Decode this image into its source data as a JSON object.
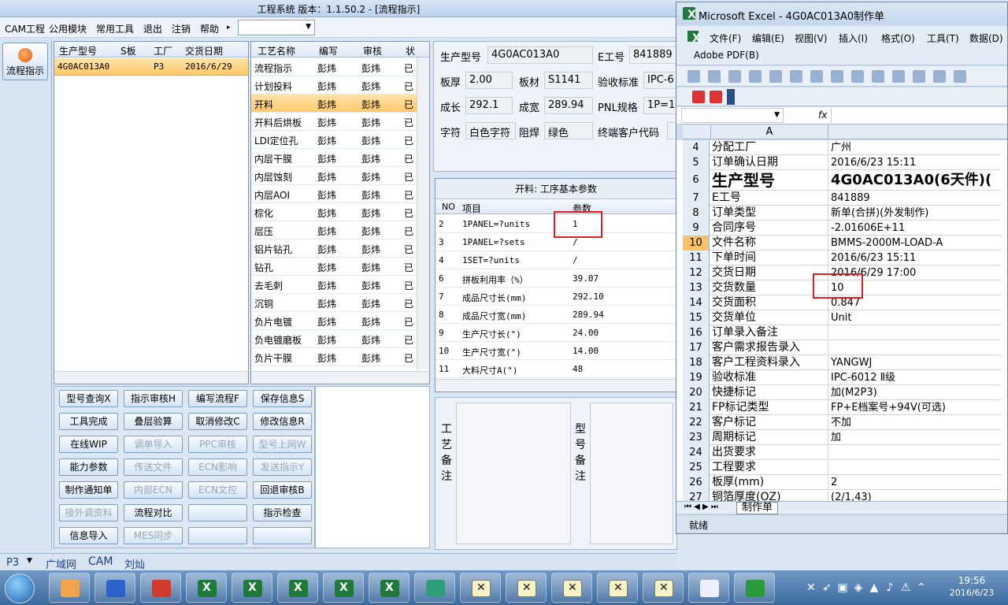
{
  "app": {
    "title": "工程系统   版本：1.1.50.2 - [流程指示]",
    "menu": [
      "CAM工程",
      "公用模块",
      "常用工具",
      "退出",
      "注销",
      "帮助"
    ],
    "menu_help_arrow": "▸",
    "combo_value": ""
  },
  "leftnav": {
    "flow_button": "流程指示"
  },
  "orders": {
    "headers": [
      "生产型号",
      "S板",
      "工厂",
      "交货日期"
    ],
    "rows": [
      {
        "model": "4G0AC013A0",
        "sboard": "",
        "factory": "P3",
        "date": "2016/6/29"
      }
    ]
  },
  "process": {
    "headers": [
      "工艺名称",
      "编写",
      "审核",
      "状"
    ],
    "rows": [
      [
        "流程指示",
        "彭炜",
        "彭炜",
        "已"
      ],
      [
        "计划投料",
        "彭炜",
        "彭炜",
        "已"
      ],
      [
        "开料",
        "彭炜",
        "彭炜",
        "已"
      ],
      [
        "开料后烘板",
        "彭炜",
        "彭炜",
        "已"
      ],
      [
        "LDI定位孔",
        "彭炜",
        "彭炜",
        "已"
      ],
      [
        "内层干膜",
        "彭炜",
        "彭炜",
        "已"
      ],
      [
        "内层蚀刻",
        "彭炜",
        "彭炜",
        "已"
      ],
      [
        "内层AOI",
        "彭炜",
        "彭炜",
        "已"
      ],
      [
        "棕化",
        "彭炜",
        "彭炜",
        "已"
      ],
      [
        "层压",
        "彭炜",
        "彭炜",
        "已"
      ],
      [
        "铝片钻孔",
        "彭炜",
        "彭炜",
        "已"
      ],
      [
        "钻孔",
        "彭炜",
        "彭炜",
        "已"
      ],
      [
        "去毛刺",
        "彭炜",
        "彭炜",
        "已"
      ],
      [
        "沉铜",
        "彭炜",
        "彭炜",
        "已"
      ],
      [
        "负片电镀",
        "彭炜",
        "彭炜",
        "已"
      ],
      [
        "负电镀磨板",
        "彭炜",
        "彭炜",
        "已"
      ],
      [
        "负片干膜",
        "彭炜",
        "彭炜",
        "已"
      ]
    ]
  },
  "info": {
    "model_label": "生产型号",
    "model": "4G0AC013A0",
    "eno_label": "E工号",
    "eno": "841889",
    "thick_label": "板厚",
    "thick": "2.00",
    "material_label": "板材",
    "material": "S1141",
    "std_label": "验收标准",
    "std": "IPC-6",
    "len_label": "成长",
    "len": "292.1",
    "wid_label": "成宽",
    "wid": "289.94",
    "pnl_label": "PNL规格",
    "pnl": "1P=1",
    "char_label": "字符",
    "char": "白色字符",
    "mask_label": "阻焊",
    "mask": "绿色",
    "cust_label": "终端客户代码",
    "cust": ""
  },
  "params": {
    "title": "开料: 工序基本参数",
    "headers": [
      "NO",
      "项目",
      "参数"
    ],
    "rows": [
      [
        "2",
        "1PANEL=?units",
        "1"
      ],
      [
        "3",
        "1PANEL=?sets",
        "/"
      ],
      [
        "4",
        "1SET=?units",
        "/"
      ],
      [
        "6",
        "拼板利用率（%）",
        "39.07"
      ],
      [
        "7",
        "成品尺寸长(mm)",
        "292.10"
      ],
      [
        "8",
        "成品尺寸宽(mm)",
        "289.94"
      ],
      [
        "9",
        "生产尺寸长(\")",
        "24.00"
      ],
      [
        "10",
        "生产尺寸宽(\")",
        "14.00"
      ],
      [
        "11",
        "大料尺寸A(\")",
        "48"
      ]
    ]
  },
  "remarks": {
    "process_label": "工艺备注",
    "model_label": "型号备注"
  },
  "buttons": [
    {
      "label": "型号查询X",
      "enabled": true
    },
    {
      "label": "指示审核H",
      "enabled": true
    },
    {
      "label": "编写流程F",
      "enabled": true
    },
    {
      "label": "保存信息S",
      "enabled": true
    },
    {
      "label": "工具完成",
      "enabled": true
    },
    {
      "label": "叠层验算",
      "enabled": true
    },
    {
      "label": "取消修改C",
      "enabled": true
    },
    {
      "label": "修改信息R",
      "enabled": true
    },
    {
      "label": "在线WIP",
      "enabled": true
    },
    {
      "label": "调单导入",
      "enabled": false
    },
    {
      "label": "PPC审核",
      "enabled": false
    },
    {
      "label": "型号上网W",
      "enabled": false
    },
    {
      "label": "能力参数",
      "enabled": true
    },
    {
      "label": "传送文件",
      "enabled": false
    },
    {
      "label": "ECN影响",
      "enabled": false
    },
    {
      "label": "发送指示Y",
      "enabled": false
    },
    {
      "label": "制作通知单",
      "enabled": true
    },
    {
      "label": "内部ECN",
      "enabled": false
    },
    {
      "label": "ECN文控",
      "enabled": false
    },
    {
      "label": "回退审核B",
      "enabled": true
    },
    {
      "label": "接外调资料",
      "enabled": false
    },
    {
      "label": "流程对比",
      "enabled": true
    },
    {
      "label": "",
      "enabled": true
    },
    {
      "label": "指示检查",
      "enabled": true
    },
    {
      "label": "信息导入",
      "enabled": true
    },
    {
      "label": "MES同步",
      "enabled": false
    },
    {
      "label": "",
      "enabled": true
    },
    {
      "label": "",
      "enabled": true
    }
  ],
  "status": {
    "site": "P3",
    "network": "广域网",
    "dept": "CAM",
    "user": "刘灿"
  },
  "excel": {
    "title": "Microsoft Excel - 4G0AC013A0制作单",
    "menu": [
      "文件(F)",
      "编辑(E)",
      "视图(V)",
      "插入(I)",
      "格式(O)",
      "工具(T)",
      "数据(D)"
    ],
    "menu2": "Adobe PDF(B)",
    "fx": "fx",
    "col_header": "A",
    "rows": [
      {
        "n": "4",
        "a": "分配工厂",
        "b": "广州"
      },
      {
        "n": "5",
        "a": "订单确认日期",
        "b": "2016/6/23 15:11"
      },
      {
        "n": "6",
        "a": "生产型号",
        "b": "4G0AC013A0(6天件)("
      },
      {
        "n": "7",
        "a": "E工号",
        "b": "841889"
      },
      {
        "n": "8",
        "a": "订单类型",
        "b": "新单(合拼)(外发制作)"
      },
      {
        "n": "9",
        "a": "合同序号",
        "b": "-2.01606E+11"
      },
      {
        "n": "10",
        "a": "文件名称",
        "b": "BMMS-2000M-LOAD-A"
      },
      {
        "n": "11",
        "a": "下单时间",
        "b": "2016/6/23 15:11"
      },
      {
        "n": "12",
        "a": "交货日期",
        "b": "2016/6/29 17:00"
      },
      {
        "n": "13",
        "a": "交货数量",
        "b": "10"
      },
      {
        "n": "14",
        "a": "交货面积",
        "b": "0.847"
      },
      {
        "n": "15",
        "a": "交货单位",
        "b": "Unit"
      },
      {
        "n": "16",
        "a": "订单录入备注",
        "b": ""
      },
      {
        "n": "17",
        "a": "客户需求报告录入",
        "b": ""
      },
      {
        "n": "18",
        "a": "客户工程资料录入",
        "b": "YANGWJ"
      },
      {
        "n": "19",
        "a": "验收标准",
        "b": "IPC-6012 Ⅱ级"
      },
      {
        "n": "20",
        "a": "快捷标记",
        "b": "加(M2P3)"
      },
      {
        "n": "21",
        "a": "FP标记类型",
        "b": "FP+E档案号+94V(可选)"
      },
      {
        "n": "22",
        "a": "客户标记",
        "b": "不加"
      },
      {
        "n": "23",
        "a": "周期标记",
        "b": "加"
      },
      {
        "n": "24",
        "a": "出货要求",
        "b": ""
      },
      {
        "n": "25",
        "a": "工程要求",
        "b": ""
      },
      {
        "n": "26",
        "a": "板厚(mm)",
        "b": "2"
      },
      {
        "n": "27",
        "a": "铜箔厚度(OZ)",
        "b": "(2/1,43)"
      }
    ],
    "sheet_tab": "制作单",
    "status": "就绪"
  },
  "clock": {
    "time": "19:56",
    "date": "2016/6/23"
  }
}
